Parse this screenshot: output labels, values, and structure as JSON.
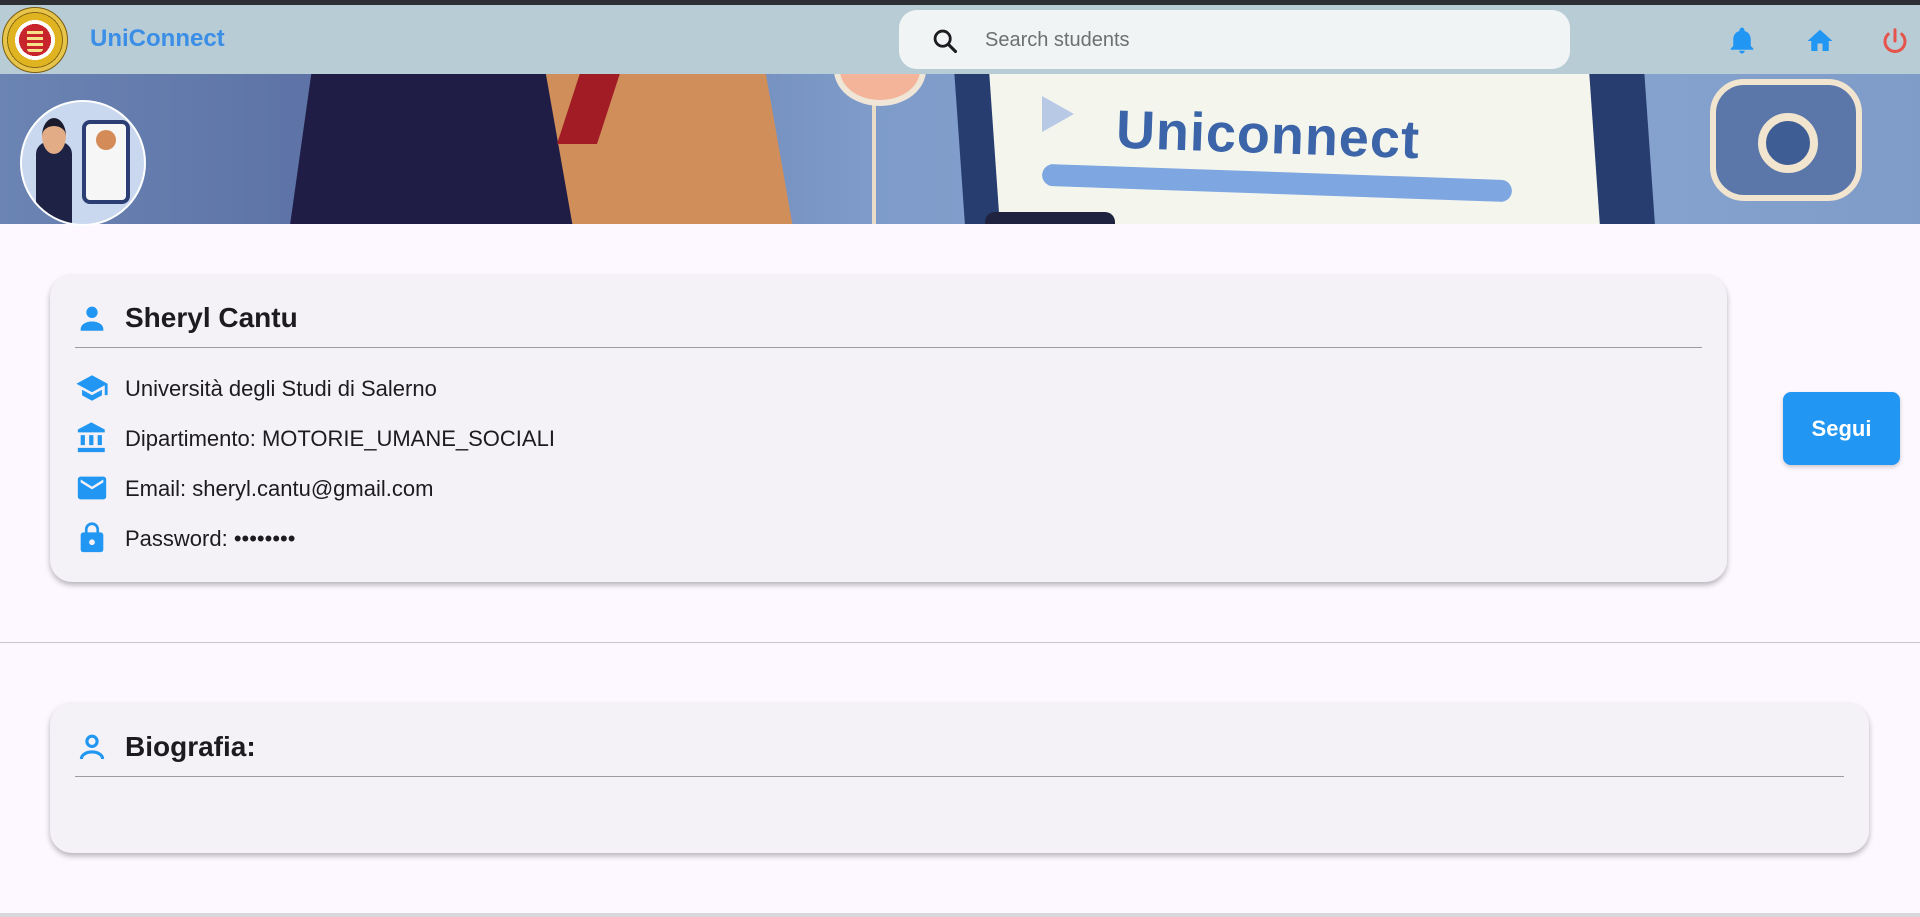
{
  "appbar": {
    "brand": "UniConnect",
    "search_placeholder": "Search students",
    "icons": [
      "bell-icon",
      "home-icon",
      "power-icon"
    ]
  },
  "banner": {
    "title": "Uniconnect"
  },
  "profile": {
    "name": "Sheryl Cantu",
    "university": "Università degli Studi di Salerno",
    "department": "Dipartimento: MOTORIE_UMANE_SOCIALI",
    "email": "Email: sheryl.cantu@gmail.com",
    "password": "Password: ••••••••"
  },
  "actions": {
    "follow_label": "Segui"
  },
  "bio": {
    "title": "Biografia:",
    "text": ""
  },
  "colors": {
    "accent": "#2196f3",
    "brand": "#3b8ee6",
    "power": "#e5534b",
    "appbar": "#b8ccd6",
    "card": "#f4f2f7"
  }
}
